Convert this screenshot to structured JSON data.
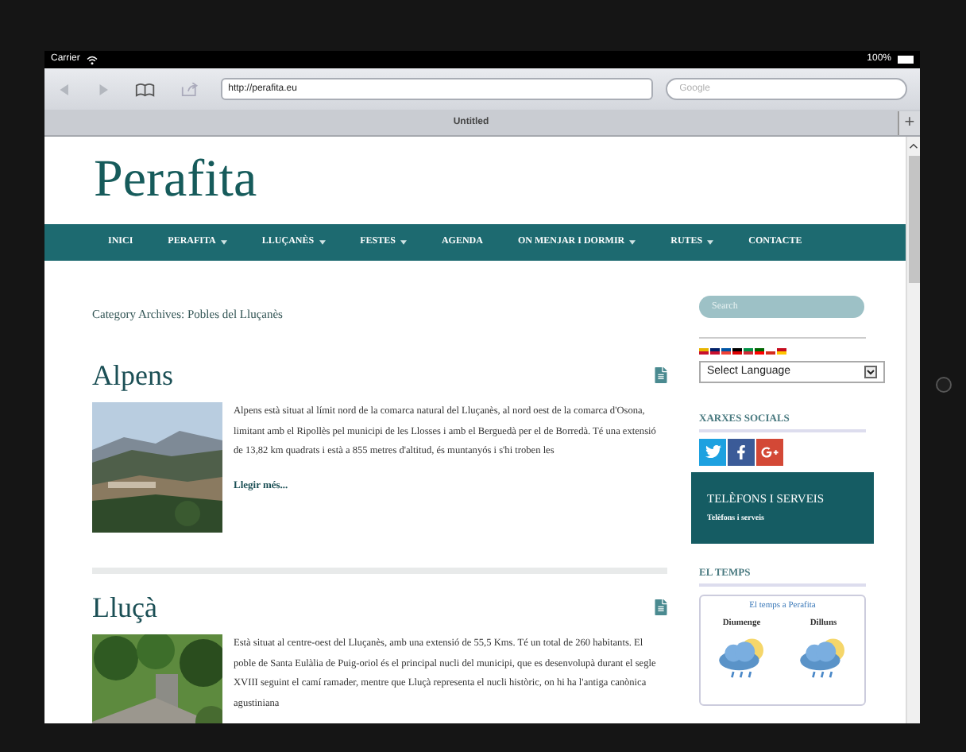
{
  "status_bar": {
    "carrier": "Carrier",
    "battery": "100%"
  },
  "browser": {
    "url": "http://perafita.eu",
    "search_placeholder": "Google",
    "tab_title": "Untitled",
    "new_tab": "+"
  },
  "site": {
    "title": "Perafita",
    "nav": [
      {
        "label": "INICI",
        "has_menu": false
      },
      {
        "label": "PERAFITA",
        "has_menu": true
      },
      {
        "label": "LLUÇANÈS",
        "has_menu": true
      },
      {
        "label": "FESTES",
        "has_menu": true
      },
      {
        "label": "AGENDA",
        "has_menu": false
      },
      {
        "label": "ON MENJAR I DORMIR",
        "has_menu": true
      },
      {
        "label": "RUTES",
        "has_menu": true
      },
      {
        "label": "CONTACTE",
        "has_menu": false
      }
    ],
    "archive_heading": "Category Archives: Pobles del Lluçanès",
    "posts": [
      {
        "title": "Alpens",
        "excerpt": "Alpens està situat al límit nord de la comarca natural del Lluçanès, al nord oest de la comarca d'Osona, limitant amb el Ripollès pel municipi de les Llosses i amb el Berguedà per el de Borredà. Té una extensió de 13,82 km quadrats i està a 855 metres d'altitud, és muntanyós i s'hi troben les",
        "read_more": "Llegir més..."
      },
      {
        "title": "Lluçà",
        "excerpt": "Està situat al centre-oest del Lluçanès, amb una extensió de 55,5 Kms. Té un total de 260 habitants. El poble de Santa Eulàlia de Puig-oriol és el principal nucli del municipi, que es desenvolupà durant el segle XVIII seguint el camí ramader, mentre que Lluçà representa el nucli històric, on hi ha l'antiga canònica agustiniana"
      }
    ],
    "sidebar": {
      "search_placeholder": "Search",
      "language_select": "Select Language",
      "social_heading": "XARXES SOCIALS",
      "phone_box": {
        "title": "TELÈFONS I SERVEIS",
        "link": "Telèfons i serveis"
      },
      "weather": {
        "heading": "EL TEMPS",
        "title": "El temps a Perafita",
        "days": [
          "Diumenge",
          "Dilluns"
        ]
      }
    }
  }
}
